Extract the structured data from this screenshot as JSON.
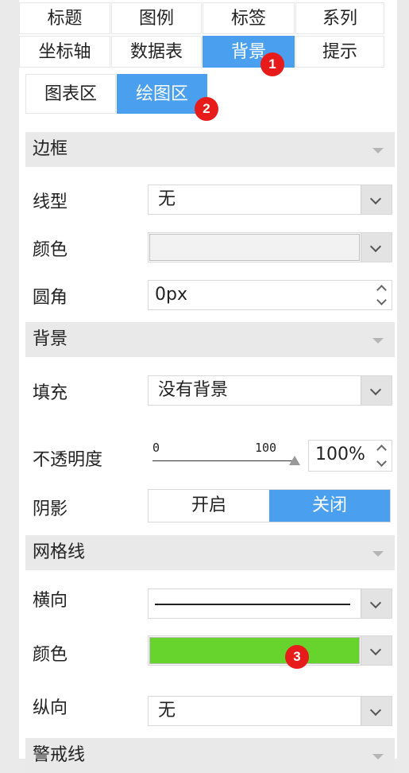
{
  "tabs_row1": [
    "标题",
    "图例",
    "标签",
    "系列"
  ],
  "tabs_row2": [
    "坐标轴",
    "数据表",
    "背景",
    "提示"
  ],
  "active_tab": "背景",
  "subtabs": [
    "图表区",
    "绘图区"
  ],
  "active_subtab": "绘图区",
  "badges": [
    "1",
    "2",
    "3"
  ],
  "border_section": {
    "title": "边框",
    "line_label": "线型",
    "line_value": "无",
    "color_label": "颜色",
    "color_value": "#f2f2f2",
    "radius_label": "圆角",
    "radius_value": "0px"
  },
  "background_section": {
    "title": "背景",
    "fill_label": "填充",
    "fill_value": "没有背景",
    "opacity_label": "不透明度",
    "slider_min": "0",
    "slider_max": "100",
    "opacity_level": 1.0,
    "opacity_value": "100%",
    "shadow_label": "阴影",
    "shadow_on": "开启",
    "shadow_off": "关闭",
    "shadow_selected": "关闭"
  },
  "grid_section": {
    "title": "网格线",
    "horizontal_label": "横向",
    "horizontal_value": "solid-line",
    "color_label": "颜色",
    "color_value": "#66d42d",
    "vertical_label": "纵向",
    "vertical_value": "无"
  },
  "next_section_title": "警戒线",
  "colors": {
    "accent": "#4a9fef",
    "badge": "#e81b1b",
    "section_bg": "#e9e9e9"
  }
}
